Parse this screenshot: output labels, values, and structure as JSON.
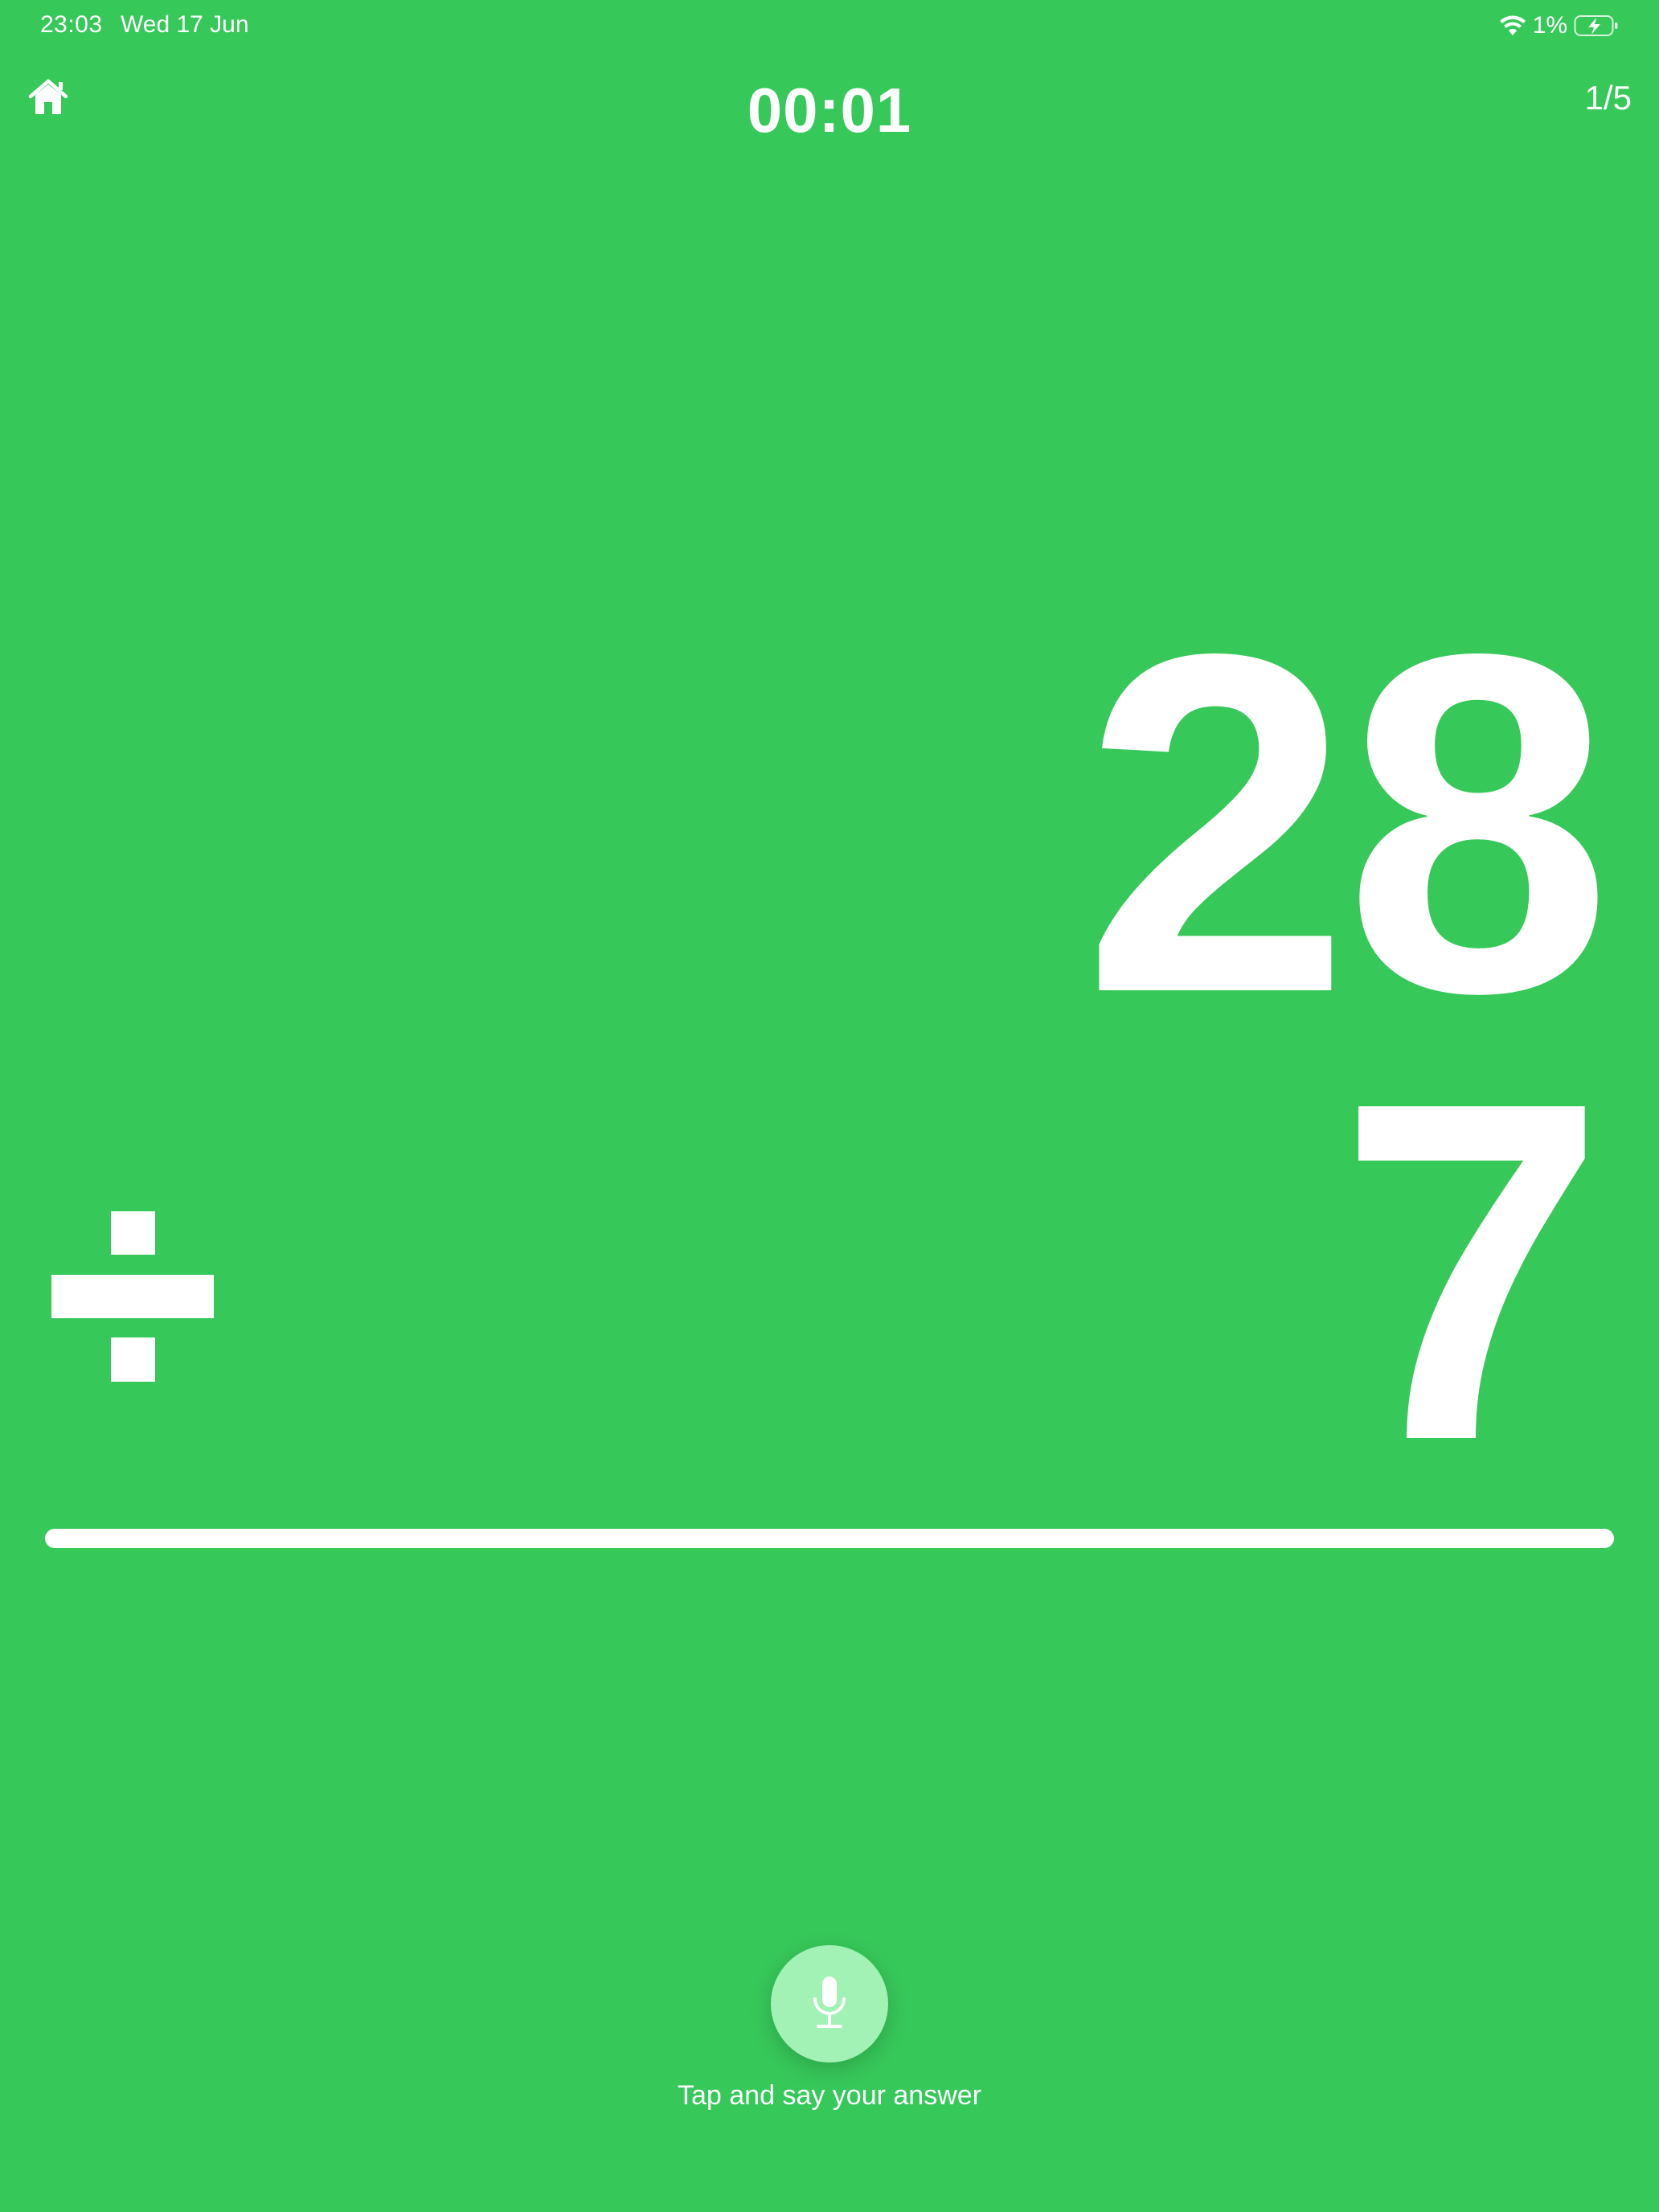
{
  "status_bar": {
    "time": "23:03",
    "date": "Wed 17 Jun",
    "battery_percent": "1%",
    "icons": [
      "wifi-icon",
      "battery-charging-icon"
    ]
  },
  "header": {
    "home_icon": "home-icon",
    "timer": "00:01",
    "progress": "1/5"
  },
  "problem": {
    "dividend": "28",
    "divisor": "7",
    "operator_icon": "divide-icon"
  },
  "voice_input": {
    "icon": "microphone-icon",
    "hint": "Tap and say your answer"
  },
  "colors": {
    "background": "#37C85A",
    "foreground": "#FFFFFF",
    "mic_button": "#A3F2B5"
  }
}
